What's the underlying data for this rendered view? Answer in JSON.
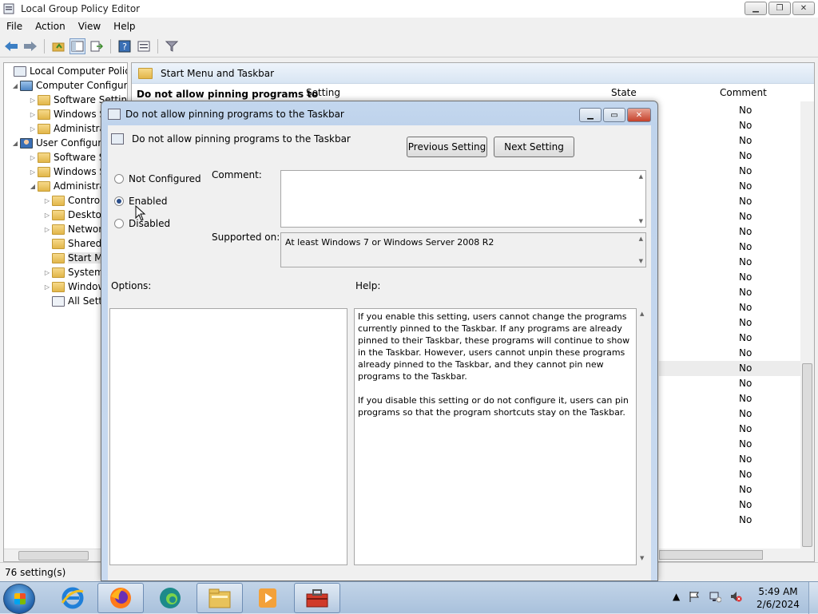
{
  "window": {
    "title": "Local Group Policy Editor",
    "controls": [
      "minimize",
      "restore",
      "close"
    ]
  },
  "menu": [
    "File",
    "Action",
    "View",
    "Help"
  ],
  "toolbar": {
    "icons": [
      "back-icon",
      "forward-icon",
      "up-folder-icon",
      "show-hide-tree-icon",
      "export-list-icon",
      "help-icon",
      "properties-icon",
      "filter-icon"
    ]
  },
  "tree": {
    "items": [
      {
        "label": "Local Computer Policy",
        "level": 0,
        "arrow": "",
        "type": "root"
      },
      {
        "label": "Computer Configura",
        "level": 1,
        "arrow": "◢",
        "type": "computer"
      },
      {
        "label": "Software Settings",
        "level": 2,
        "arrow": "▷",
        "type": "folder"
      },
      {
        "label": "Windows S",
        "level": 2,
        "arrow": "▷",
        "type": "folder"
      },
      {
        "label": "Administra",
        "level": 2,
        "arrow": "▷",
        "type": "folder"
      },
      {
        "label": "User Configura",
        "level": 1,
        "arrow": "◢",
        "type": "user"
      },
      {
        "label": "Software Se",
        "level": 2,
        "arrow": "▷",
        "type": "folder"
      },
      {
        "label": "Windows S",
        "level": 2,
        "arrow": "▷",
        "type": "folder"
      },
      {
        "label": "Administra",
        "level": 2,
        "arrow": "◢",
        "type": "folder"
      },
      {
        "label": "Contro",
        "level": 3,
        "arrow": "▷",
        "type": "folder"
      },
      {
        "label": "Desktop",
        "level": 3,
        "arrow": "▷",
        "type": "folder"
      },
      {
        "label": "Networ",
        "level": 3,
        "arrow": "▷",
        "type": "folder"
      },
      {
        "label": "Shared",
        "level": 3,
        "arrow": "",
        "type": "folder"
      },
      {
        "label": "Start M",
        "level": 3,
        "arrow": "",
        "type": "folder",
        "selected": true
      },
      {
        "label": "System",
        "level": 3,
        "arrow": "▷",
        "type": "folder"
      },
      {
        "label": "Window",
        "level": 3,
        "arrow": "▷",
        "type": "folder"
      },
      {
        "label": "All Setti",
        "level": 3,
        "arrow": "",
        "type": "all"
      }
    ]
  },
  "right_pane": {
    "header": "Start Menu and Taskbar",
    "selected_title": "Do not allow pinning programs to",
    "columns": {
      "setting": "Setting",
      "state": "State",
      "comment": "Comment"
    },
    "comment_values": [
      "No",
      "No",
      "No",
      "No",
      "No",
      "No",
      "No",
      "No",
      "No",
      "No",
      "No",
      "No",
      "No",
      "No",
      "No",
      "No",
      "No",
      "No",
      "No",
      "No",
      "No",
      "No",
      "No",
      "No",
      "No",
      "No",
      "No",
      "No"
    ]
  },
  "status": "76 setting(s)",
  "dialog": {
    "title": "Do not allow pinning programs to the Taskbar",
    "heading": "Do not allow pinning programs to the Taskbar",
    "prev_button": "Previous Setting",
    "next_button": "Next Setting",
    "options": {
      "not_configured": "Not Configured",
      "enabled": "Enabled",
      "disabled": "Disabled",
      "selected": "enabled"
    },
    "comment_label": "Comment:",
    "comment_value": "",
    "supported_label": "Supported on:",
    "supported_value": "At least Windows 7 or Windows Server 2008 R2",
    "options_label": "Options:",
    "help_label": "Help:",
    "help_text": "If you enable this setting, users cannot change the programs currently pinned to the Taskbar. If any programs are already pinned to their Taskbar, these programs will continue to show in the Taskbar. However, users cannot unpin these programs already pinned to the Taskbar, and they cannot pin new programs to the Taskbar.\n\nIf you disable this setting or do not configure it, users can pin programs so that the program shortcuts stay on the Taskbar."
  },
  "taskbar": {
    "items": [
      "start-button",
      "ie-icon",
      "firefox-icon",
      "edge-icon",
      "explorer-icon",
      "media-player-icon",
      "toolbox-icon"
    ],
    "time": "5:49 AM",
    "date": "2/6/2024"
  }
}
